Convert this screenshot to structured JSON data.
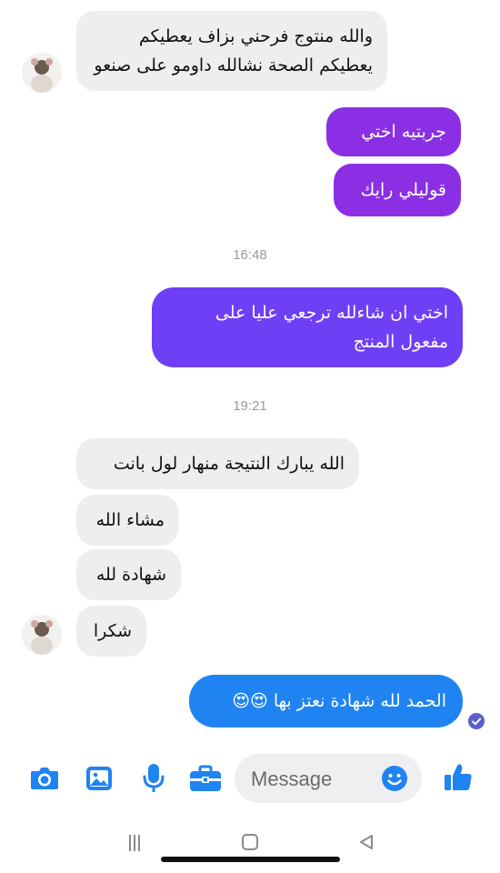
{
  "messages": [
    {
      "id": "m1",
      "text": "والله منتوج فرحني بزاف يعطيكم\nيعطيكم الصحة نشالله داومو على صنعو"
    },
    {
      "id": "m2",
      "text": "جربتيه اختي"
    },
    {
      "id": "m3",
      "text": "قوليلي رايك"
    },
    {
      "id": "m4",
      "text": "اختي ان شاءلله ترجعي عليا على\nمفعول المنتج"
    },
    {
      "id": "m5",
      "text": "الله يبارك النتيجة منهار لول بانت"
    },
    {
      "id": "m6",
      "text": "مشاء الله"
    },
    {
      "id": "m7",
      "text": "شهادة لله"
    },
    {
      "id": "m8",
      "text": "شكرا"
    },
    {
      "id": "m9",
      "text": "الحمد لله شهادة نعتز بها 😍😍"
    }
  ],
  "timestamps": [
    "16:48",
    "19:21"
  ],
  "composer": {
    "placeholder": "Message"
  },
  "icons": {
    "toolbar": [
      "camera-icon",
      "gallery-icon",
      "microphone-icon",
      "briefcase-icon",
      "emoji-icon",
      "thumbs-up-icon"
    ],
    "nav": [
      "recents-icon",
      "home-icon",
      "back-icon"
    ],
    "status": "read-receipt-icon"
  },
  "colors": {
    "accent": "#1f84f1",
    "purple": "#8a2fe3",
    "violet": "#6e3ff5",
    "incoming": "#eeeef0"
  }
}
